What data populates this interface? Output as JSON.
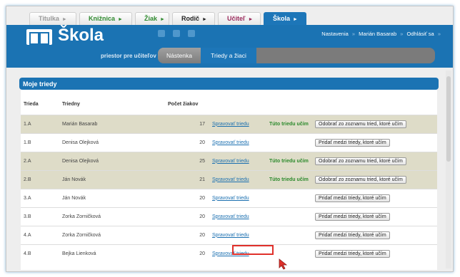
{
  "top_tabs": [
    {
      "label": "Titulka"
    },
    {
      "label": "Knižnica"
    },
    {
      "label": "Žiak"
    },
    {
      "label": "Rodič"
    },
    {
      "label": "Učiteľ"
    },
    {
      "label": "Škola"
    }
  ],
  "header": {
    "logo_title": "Škola",
    "logo_subtitle": "priestor pre učiteľov školy",
    "user_nav": {
      "settings": "Nastavenia",
      "user": "Marián Basarab",
      "logout": "Odhlásiť sa"
    },
    "subnav": [
      {
        "label": "Nástenka"
      },
      {
        "label": "Triedy a žiaci"
      }
    ]
  },
  "panel": {
    "title": "Moje triedy",
    "columns": {
      "class": "Trieda",
      "teacher": "Triedny",
      "count": "Počet žiakov"
    },
    "rows": [
      {
        "class": "1.A",
        "teacher": "Marián Basarab",
        "count": "17",
        "manage": "Spravovať triedu",
        "mine": "Túto triedu učím",
        "action": "Odobrať zo zoznamu tried, ktoré učím",
        "shaded": true
      },
      {
        "class": "1.B",
        "teacher": "Denisa Olejková",
        "count": "20",
        "manage": "Spravovať triedu",
        "mine": "",
        "action": "Pridať medzi triedy, ktoré učím",
        "shaded": false
      },
      {
        "class": "2.A",
        "teacher": "Denisa Olejková",
        "count": "25",
        "manage": "Spravovať triedu",
        "mine": "Túto triedu učím",
        "action": "Odobrať zo zoznamu tried, ktoré učím",
        "shaded": true
      },
      {
        "class": "2.B",
        "teacher": "Ján Novák",
        "count": "21",
        "manage": "Spravovať triedu",
        "mine": "Túto triedu učím",
        "action": "Odobrať zo zoznamu tried, ktoré učím",
        "shaded": true
      },
      {
        "class": "3.A",
        "teacher": "Ján Novák",
        "count": "20",
        "manage": "Spravovať triedu",
        "mine": "",
        "action": "Pridať medzi triedy, ktoré učím",
        "shaded": false
      },
      {
        "class": "3.B",
        "teacher": "Zorka Zorničková",
        "count": "20",
        "manage": "Spravovať triedu",
        "mine": "",
        "action": "Pridať medzi triedy, ktoré učím",
        "shaded": false
      },
      {
        "class": "4.A",
        "teacher": "Zorka Zorničková",
        "count": "20",
        "manage": "Spravovať triedu",
        "mine": "",
        "action": "Pridať medzi triedy, ktoré učím",
        "shaded": false
      },
      {
        "class": "4.B",
        "teacher": "Bejka Lienková",
        "count": "20",
        "manage": "Spravovať triedu",
        "mine": "",
        "action": "Pridať medzi triedy, ktoré učím",
        "shaded": false
      }
    ]
  },
  "colors": {
    "brand_blue": "#1b73b3",
    "mine_green": "#2c8a2c",
    "highlight_red": "#e0302a",
    "row_shade": "#dedcc8"
  }
}
